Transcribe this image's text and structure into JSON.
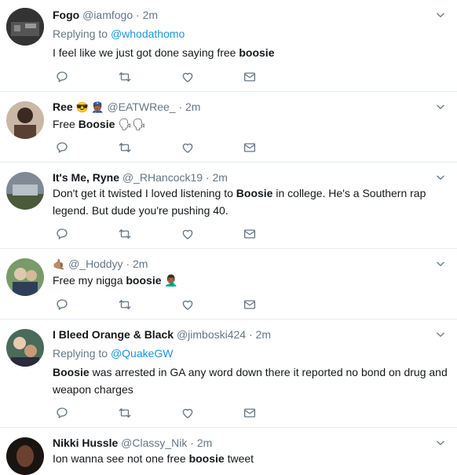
{
  "tweets": [
    {
      "name": "Fogo",
      "handle": "@iamfogo",
      "time": "· 2m",
      "replying_prefix": "Replying to",
      "replying_to": "@whodathomo",
      "text_before": "I feel like we just got done saying free ",
      "text_bold": "boosie",
      "text_after": "",
      "avatar_icon": "avatar-photo"
    },
    {
      "name": "Ree",
      "name_emojis": "😎 👮🏾",
      "handle": "@EATWRee_",
      "time": "· 2m",
      "text_before": "Free ",
      "text_bold": "Boosie",
      "text_after": " 🗣🗣",
      "avatar_icon": "avatar-photo"
    },
    {
      "name": "It's Me, Ryne",
      "handle": "@_RHancock19",
      "time": "· 2m",
      "text_before": "Don't get it twisted I loved listening to ",
      "text_bold": "Boosie",
      "text_after": " in college. He's a Southern rap legend. But dude you're pushing 40.",
      "avatar_icon": "avatar-photo"
    },
    {
      "name_emoji": "🤙🏽",
      "handle": "@_Hoddyy",
      "time": "· 2m",
      "text_before": "Free my nigga ",
      "text_bold": "boosie",
      "text_after": " 🤦🏾‍♂️",
      "avatar_icon": "avatar-photo"
    },
    {
      "name": "I Bleed Orange & Black",
      "handle": "@jimboski424",
      "time": "· 2m",
      "replying_prefix": "Replying to",
      "replying_to": "@QuakeGW",
      "text_bold": "Boosie",
      "text_after": " was arrested in GA any word down there it reported no bond on drug and weapon charges",
      "avatar_icon": "avatar-photo"
    },
    {
      "name": "Nikki Hussle",
      "handle": "@Classy_Nik",
      "time": "· 2m",
      "text_before": "Ion wanna see not one free ",
      "text_bold": "boosie",
      "text_after": " tweet",
      "avatar_icon": "avatar-photo"
    }
  ],
  "colors": {
    "text": "#14171a",
    "secondary": "#657786",
    "link": "#1b95e0",
    "divider": "#e6ecf0"
  },
  "icons": [
    "reply-icon",
    "retweet-icon",
    "like-icon",
    "direct-message-icon",
    "chevron-down-icon"
  ]
}
